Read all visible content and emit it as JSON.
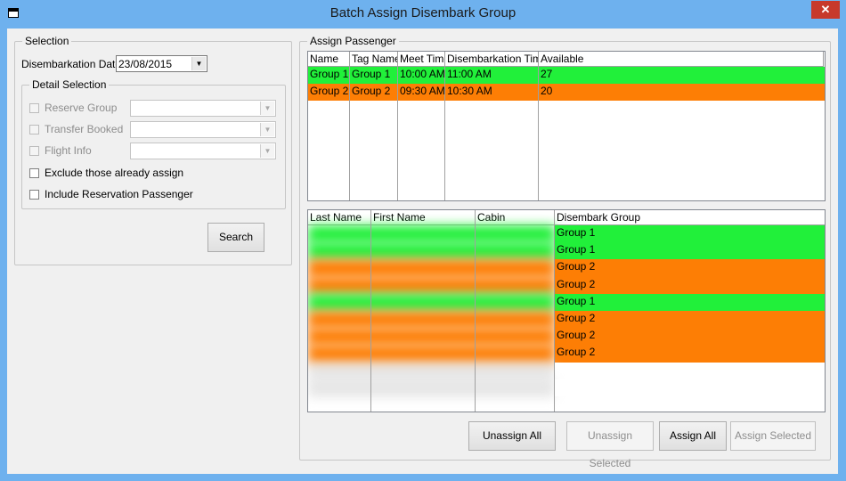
{
  "window": {
    "title": "Batch Assign Disembark Group",
    "close_glyph": "✕"
  },
  "selection": {
    "legend": "Selection",
    "date_label": "Disembarkation Date",
    "date_value": "23/08/2015",
    "detail": {
      "legend": "Detail Selection",
      "reserve_group": "Reserve Group",
      "transfer_booked": "Transfer Booked",
      "flight_info": "Flight Info",
      "exclude_assigned": "Exclude those already assign",
      "include_reservation": "Include Reservation Passenger"
    },
    "search_label": "Search"
  },
  "assign": {
    "legend": "Assign Passenger",
    "group_columns": [
      "Name",
      "Tag Name",
      "Meet Time",
      "Disembarkation Time",
      "Available"
    ],
    "groups": [
      {
        "name": "Group 1",
        "tag": "Group 1",
        "meet": "10:00 AM",
        "disembark": "11:00 AM",
        "available": "27",
        "color": "#21f03a"
      },
      {
        "name": "Group 2",
        "tag": "Group 2",
        "meet": "09:30 AM",
        "disembark": "10:30 AM",
        "available": "20",
        "color": "#fd7e05"
      }
    ],
    "passenger_columns": [
      "Last Name",
      "First Name",
      "Cabin",
      "Disembark Group"
    ],
    "passenger_rows": [
      {
        "group": "Group 1",
        "color": "#21f03a"
      },
      {
        "group": "Group 1",
        "color": "#21f03a"
      },
      {
        "group": "Group 2",
        "color": "#fd7e05"
      },
      {
        "group": "Group 2",
        "color": "#fd7e05"
      },
      {
        "group": "Group 1",
        "color": "#21f03a"
      },
      {
        "group": "Group 2",
        "color": "#fd7e05"
      },
      {
        "group": "Group 2",
        "color": "#fd7e05"
      },
      {
        "group": "Group 2",
        "color": "#fd7e05"
      },
      {
        "group": "",
        "color": "#ffffff"
      },
      {
        "group": "",
        "color": "#ffffff"
      }
    ],
    "buttons": {
      "unassign_all": "Unassign All",
      "unassign_selected": "Unassign Selected",
      "assign_all": "Assign All",
      "assign_selected": "Assign Selected"
    }
  },
  "colors": {
    "titlebar": "#6eb1ee",
    "green": "#21f03a",
    "orange": "#fd7e05",
    "close": "#c7392b"
  },
  "icons": {
    "app": "window-icon",
    "close": "close-icon",
    "dropdown": "chevron-down-icon"
  }
}
